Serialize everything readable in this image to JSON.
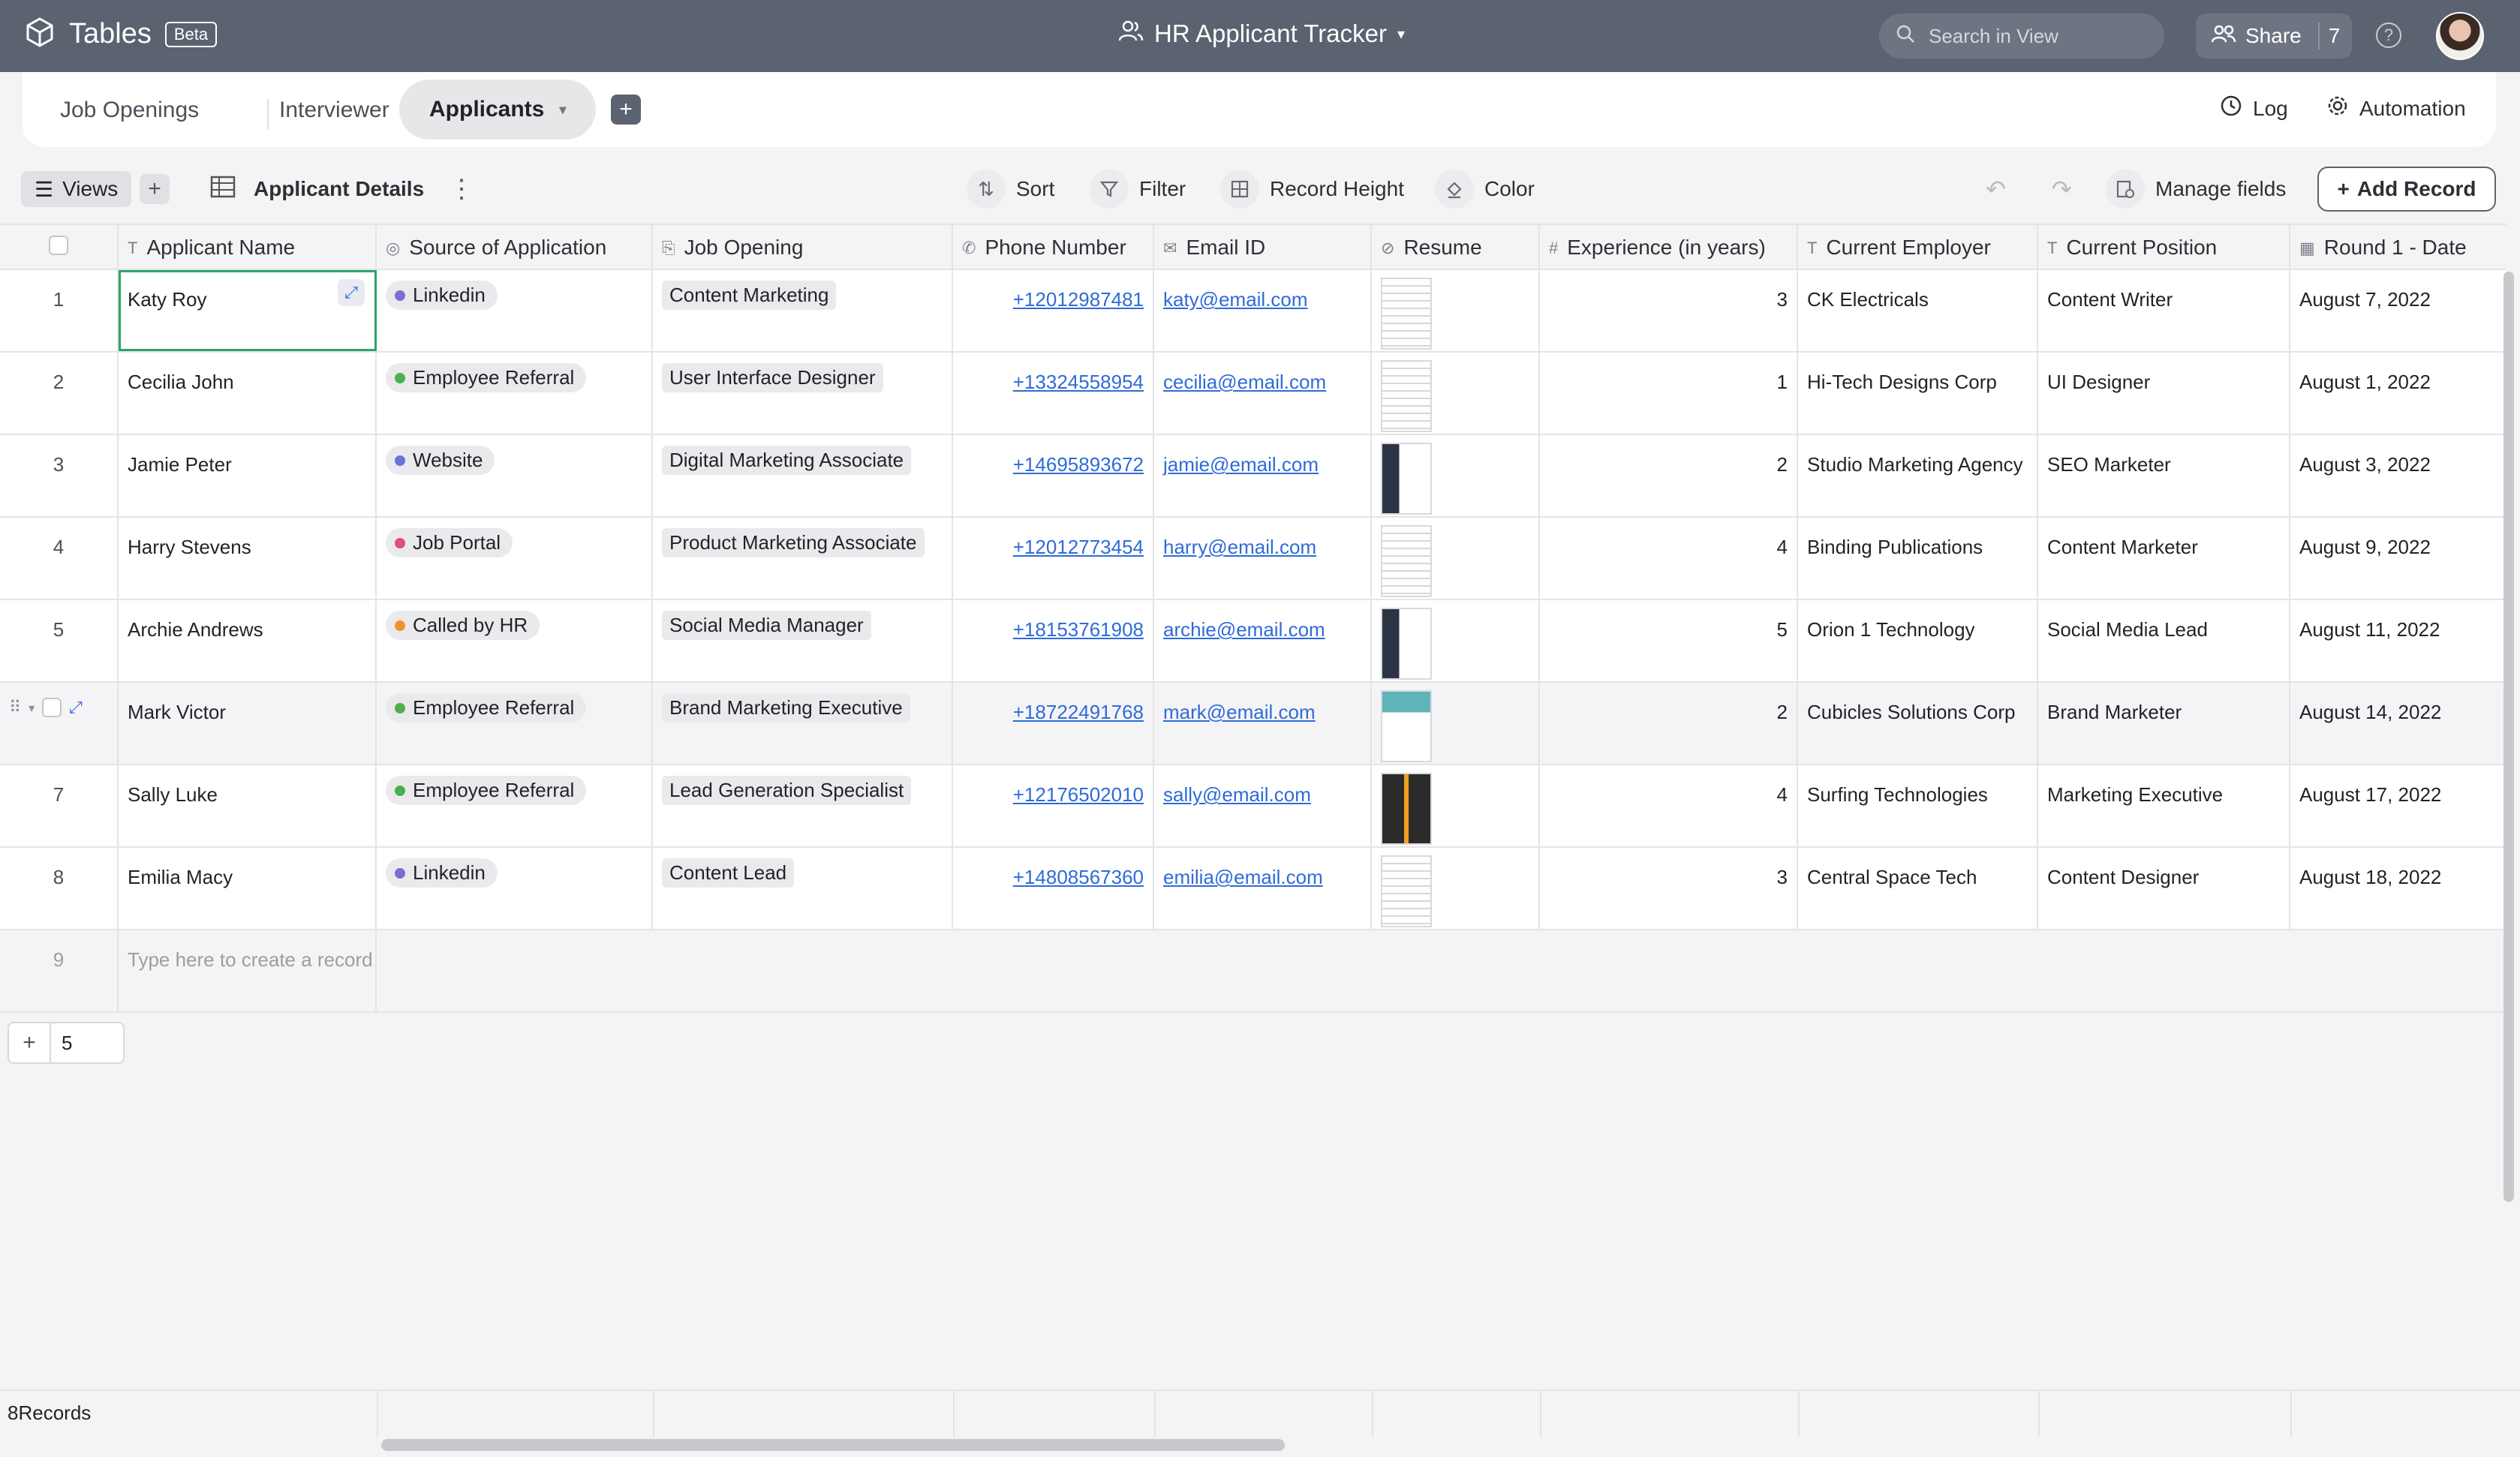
{
  "app": {
    "name": "Tables",
    "badge": "Beta",
    "title": "HR Applicant Tracker"
  },
  "search": {
    "placeholder": "Search in View"
  },
  "share": {
    "label": "Share",
    "count": "7"
  },
  "tabs": [
    {
      "label": "Job Openings"
    },
    {
      "label": "Interviewer"
    },
    {
      "label": "Applicants"
    }
  ],
  "tab_actions": {
    "log": "Log",
    "automation": "Automation"
  },
  "toolbar": {
    "views": "Views",
    "view_name": "Applicant Details",
    "sort": "Sort",
    "filter": "Filter",
    "record_height": "Record Height",
    "color": "Color",
    "manage_fields": "Manage fields",
    "add_record": "Add Record"
  },
  "columns": [
    "Applicant Name",
    "Source of Application",
    "Job Opening",
    "Phone Number",
    "Email ID",
    "Resume",
    "Experience (in years)",
    "Current Employer",
    "Current Position",
    "Round 1 -  Date"
  ],
  "rows": [
    {
      "n": "1",
      "name": "Katy Roy",
      "source": "Linkedin",
      "source_color": "#7b6fd6",
      "job": "Content Marketing",
      "phone": "+12012987481",
      "email": "katy@email.com",
      "exp": "3",
      "employer": "CK Electricals",
      "position": "Content Writer",
      "date": "August 7, 2022"
    },
    {
      "n": "2",
      "name": "Cecilia John",
      "source": "Employee Referral",
      "source_color": "#4caf50",
      "job": "User Interface Designer",
      "phone": "+13324558954",
      "email": "cecilia@email.com",
      "exp": "1",
      "employer": "Hi-Tech Designs Corp",
      "position": "UI Designer",
      "date": "August 1, 2022"
    },
    {
      "n": "3",
      "name": "Jamie Peter",
      "source": "Website",
      "source_color": "#6b73d6",
      "job": "Digital Marketing Associate",
      "phone": "+14695893672",
      "email": "jamie@email.com",
      "exp": "2",
      "employer": "Studio Marketing Agency",
      "position": "SEO Marketer",
      "date": "August 3, 2022"
    },
    {
      "n": "4",
      "name": "Harry Stevens",
      "source": "Job Portal",
      "source_color": "#e0507a",
      "job": "Product Marketing Associate",
      "phone": "+12012773454",
      "email": "harry@email.com",
      "exp": "4",
      "employer": "Binding Publications",
      "position": "Content Marketer",
      "date": "August 9, 2022"
    },
    {
      "n": "5",
      "name": "Archie Andrews",
      "source": "Called by HR",
      "source_color": "#f0902f",
      "job": "Social Media Manager",
      "phone": "+18153761908",
      "email": "archie@email.com",
      "exp": "5",
      "employer": "Orion 1 Technology",
      "position": "Social Media Lead",
      "date": "August 11, 2022"
    },
    {
      "n": "",
      "name": "Mark Victor",
      "source": "Employee Referral",
      "source_color": "#4caf50",
      "job": "Brand Marketing Executive",
      "phone": "+18722491768",
      "email": "mark@email.com",
      "exp": "2",
      "employer": "Cubicles Solutions Corp",
      "position": "Brand Marketer",
      "date": "August 14, 2022"
    },
    {
      "n": "7",
      "name": "Sally Luke",
      "source": "Employee Referral",
      "source_color": "#4caf50",
      "job": "Lead Generation Specialist",
      "phone": "+12176502010",
      "email": "sally@email.com",
      "exp": "4",
      "employer": "Surfing Technologies",
      "position": "Marketing Executive",
      "date": "August 17, 2022"
    },
    {
      "n": "8",
      "name": "Emilia Macy",
      "source": "Linkedin",
      "source_color": "#7b6fd6",
      "job": "Content Lead",
      "phone": "+14808567360",
      "email": "emilia@email.com",
      "exp": "3",
      "employer": "Central Space Tech",
      "position": "Content Designer",
      "date": "August 18, 2022"
    }
  ],
  "new_row": {
    "n": "9",
    "placeholder": "Type here to create a record"
  },
  "pager": {
    "value": "5"
  },
  "footer": {
    "records": "8Records"
  }
}
